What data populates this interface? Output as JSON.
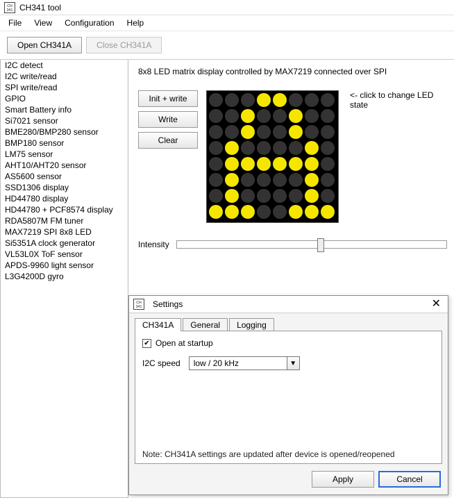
{
  "window_title": "CH341 tool",
  "menu": [
    "File",
    "View",
    "Configuration",
    "Help"
  ],
  "toolbar": {
    "open_label": "Open CH341A",
    "close_label": "Close CH341A"
  },
  "sidebar": {
    "items": [
      "I2C detect",
      "I2C write/read",
      "SPI write/read",
      "GPIO",
      "Smart Battery info",
      "Si7021 sensor",
      "BME280/BMP280 sensor",
      "BMP180 sensor",
      "LM75 sensor",
      "AHT10/AHT20 sensor",
      "AS5600 sensor",
      "SSD1306 display",
      "HD44780 display",
      "HD44780 + PCF8574 display",
      "RDA5807M FM tuner",
      "MAX7219 SPI 8x8 LED",
      "Si5351A clock generator",
      "VL53L0X ToF sensor",
      "APDS-9960 light sensor",
      "L3G4200D gyro"
    ]
  },
  "page": {
    "description": "8x8 LED matrix display controlled by MAX7219 connected over SPI",
    "buttons": {
      "init_write": "Init + write",
      "write": "Write",
      "clear": "Clear"
    },
    "hint": "<- click to change LED state",
    "intensity_label": "Intensity",
    "led_matrix": [
      [
        0,
        0,
        0,
        1,
        1,
        0,
        0,
        0
      ],
      [
        0,
        0,
        1,
        0,
        0,
        1,
        0,
        0
      ],
      [
        0,
        0,
        1,
        0,
        0,
        1,
        0,
        0
      ],
      [
        0,
        1,
        0,
        0,
        0,
        0,
        1,
        0
      ],
      [
        0,
        1,
        1,
        1,
        1,
        1,
        1,
        0
      ],
      [
        0,
        1,
        0,
        0,
        0,
        0,
        1,
        0
      ],
      [
        0,
        1,
        0,
        0,
        0,
        0,
        1,
        0
      ],
      [
        1,
        1,
        1,
        0,
        0,
        1,
        1,
        1
      ]
    ]
  },
  "dialog": {
    "title": "Settings",
    "tabs": [
      "CH341A",
      "General",
      "Logging"
    ],
    "active_tab": 0,
    "open_at_startup_label": "Open at startup",
    "open_at_startup_checked": true,
    "i2c_speed_label": "I2C speed",
    "i2c_speed_value": "low / 20 kHz",
    "note": "Note: CH341A settings are updated after device is opened/reopened",
    "apply": "Apply",
    "cancel": "Cancel"
  }
}
